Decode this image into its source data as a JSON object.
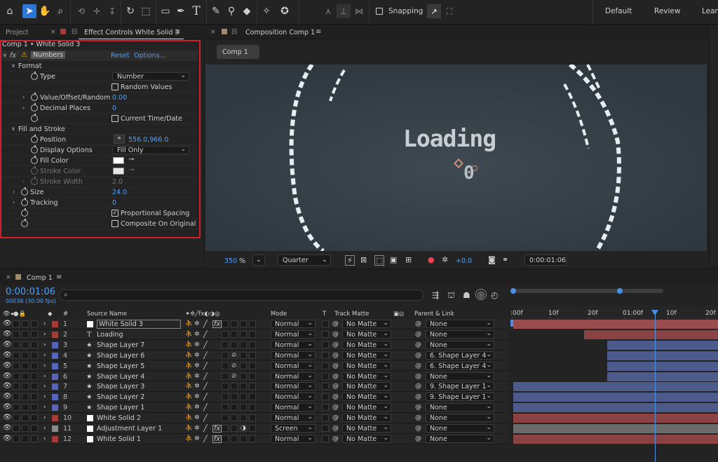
{
  "toolbar": {
    "snapping_label": "Snapping",
    "workspaces": [
      "Default",
      "Review",
      "Learn"
    ],
    "tools": [
      "home-icon",
      "selection-tool-icon",
      "hand-tool-icon",
      "zoom-tool-icon",
      "orbit-tool-icon",
      "move-tool-icon",
      "dolly-tool-icon",
      "rotate-tool-icon",
      "pan-behind-tool-icon",
      "rectangle-tool-icon",
      "pen-tool-icon",
      "type-tool-icon",
      "brush-tool-icon",
      "clone-stamp-icon",
      "eraser-tool-icon",
      "roto-brush-icon",
      "puppet-tool-icon"
    ]
  },
  "left_panel": {
    "project_tab": "Project",
    "effect_tab": "Effect Controls White Solid 3",
    "breadcrumb": "Comp 1 • White Solid 3",
    "effect": {
      "name": "Numbers",
      "reset": "Reset",
      "options": "Options..."
    },
    "rows": {
      "format": "Format",
      "type_label": "Type",
      "type_value": "Number",
      "random_values": "Random Values",
      "value_offset_label": "Value/Offset/Random",
      "value_offset_value": "0.00",
      "decimal_label": "Decimal Places",
      "decimal_value": "0",
      "current_time": "Current Time/Date",
      "fill_stroke": "Fill and Stroke",
      "position_label": "Position",
      "position_value": "556.0,966.0",
      "display_label": "Display Options",
      "display_value": "Fill Only",
      "fill_color_label": "Fill Color",
      "stroke_color_label": "Stroke Color",
      "stroke_width_label": "Stroke Width",
      "stroke_width_value": "2.0",
      "size_label": "Size",
      "size_value": "24.0",
      "tracking_label": "Tracking",
      "tracking_value": "0",
      "proportional": "Proportional Spacing",
      "composite": "Composite On Original"
    }
  },
  "composition": {
    "tab": "Composition Comp 1",
    "comp_button": "Comp 1",
    "loading_text": "Loading",
    "counter_text": "0",
    "zoom_value": "350",
    "zoom_unit": "%",
    "resolution": "Quarter",
    "exposure": "+0.0",
    "timecode": "0:00:01:06"
  },
  "timeline": {
    "tab": "Comp 1",
    "timecode": "0:00:01:06",
    "frames": "00036 (30.00 fps)",
    "headers": {
      "num": "#",
      "source_name": "Source Name",
      "mode": "Mode",
      "t": "T",
      "track_matte": "Track Matte",
      "parent": "Parent & Link"
    },
    "ruler": [
      ":00f",
      "10f",
      "20f",
      "01:00f",
      "10f",
      "20f"
    ],
    "layers": [
      {
        "num": "1",
        "name": "White Solid 3",
        "color": "#a33b3b",
        "icon": "solid",
        "mode": "Normal",
        "matte": "No Matte",
        "parent": "None",
        "fx": true,
        "bar": "#9a4b4b"
      },
      {
        "num": "2",
        "name": "Loading",
        "color": "#a33b3b",
        "icon": "text",
        "mode": "Normal",
        "matte": "No Matte",
        "parent": "None",
        "fx": false,
        "bar": "#8b4242"
      },
      {
        "num": "3",
        "name": "Shape Layer 7",
        "color": "#5566b8",
        "icon": "shape",
        "mode": "Normal",
        "matte": "No Matte",
        "parent": "None",
        "fx": false,
        "bar": "#4c5a8c"
      },
      {
        "num": "4",
        "name": "Shape Layer 6",
        "color": "#5566b8",
        "icon": "shape",
        "mode": "Normal",
        "matte": "No Matte",
        "parent": "6. Shape Layer 4",
        "fx": false,
        "bar": "#4c5a8c"
      },
      {
        "num": "5",
        "name": "Shape Layer 5",
        "color": "#5566b8",
        "icon": "shape",
        "mode": "Normal",
        "matte": "No Matte",
        "parent": "6. Shape Layer 4",
        "fx": false,
        "bar": "#4c5a8c"
      },
      {
        "num": "6",
        "name": "Shape Layer 4",
        "color": "#5566b8",
        "icon": "shape",
        "mode": "Normal",
        "matte": "No Matte",
        "parent": "None",
        "fx": false,
        "bar": "#4c5a8c"
      },
      {
        "num": "7",
        "name": "Shape Layer 3",
        "color": "#5566b8",
        "icon": "shape",
        "mode": "Normal",
        "matte": "No Matte",
        "parent": "9. Shape Layer 1",
        "fx": false,
        "bar": "#4c5a8c"
      },
      {
        "num": "8",
        "name": "Shape Layer 2",
        "color": "#5566b8",
        "icon": "shape",
        "mode": "Normal",
        "matte": "No Matte",
        "parent": "9. Shape Layer 1",
        "fx": false,
        "bar": "#4c5a8c"
      },
      {
        "num": "9",
        "name": "Shape Layer 1",
        "color": "#5566b8",
        "icon": "shape",
        "mode": "Normal",
        "matte": "No Matte",
        "parent": "None",
        "fx": false,
        "bar": "#4c5a8c"
      },
      {
        "num": "10",
        "name": "White Solid 2",
        "color": "#a33b3b",
        "icon": "solid",
        "mode": "Normal",
        "matte": "No Matte",
        "parent": "None",
        "fx": false,
        "bar": "#8b4242"
      },
      {
        "num": "11",
        "name": "Adjustment Layer 1",
        "color": "#8a8a8a",
        "icon": "adjust",
        "mode": "Screen",
        "matte": "No Matte",
        "parent": "None",
        "fx": true,
        "bar": "#6b6b6b"
      },
      {
        "num": "12",
        "name": "White Solid 1",
        "color": "#a33b3b",
        "icon": "solid",
        "mode": "Normal",
        "matte": "No Matte",
        "parent": "None",
        "fx": true,
        "bar": "#8b4242"
      }
    ]
  },
  "colors": {
    "accent": "#2d76d6",
    "link": "#4ea0ff",
    "highlight_border": "#d01f2a",
    "playhead": "#4a90e2"
  }
}
